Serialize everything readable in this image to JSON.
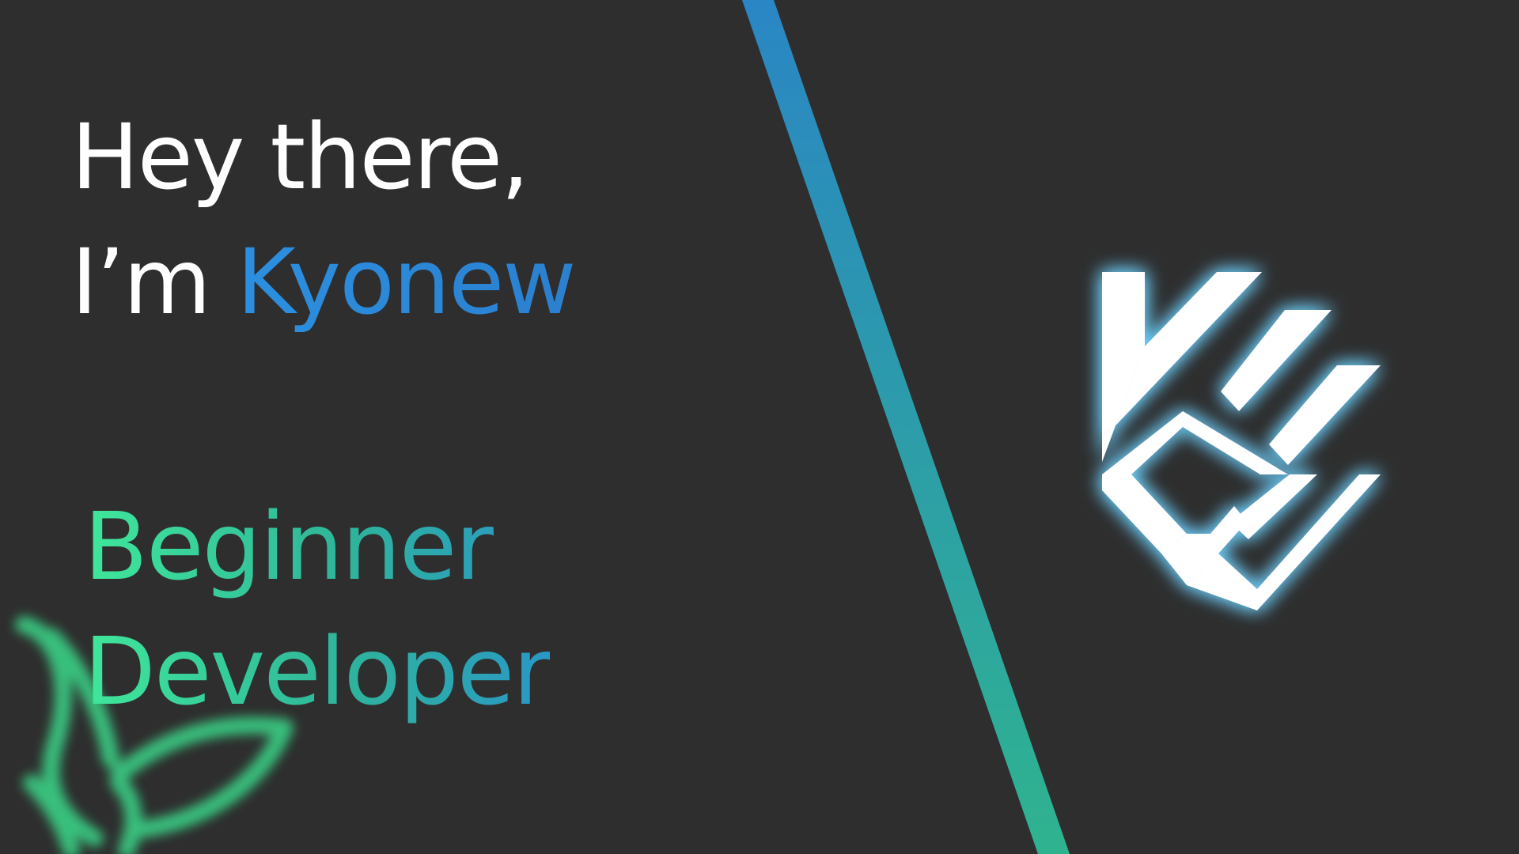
{
  "hero": {
    "greeting_line": "Hey there,",
    "intro_prefix": "I’m ",
    "name": "Kyonew",
    "role_line1": "Beginner",
    "role_line2": "Developer"
  },
  "colors": {
    "background": "#2e2e2e",
    "text_primary": "#ffffff",
    "name_accent": "#2c8fe0",
    "role_gradient_start": "#3fe79a",
    "role_gradient_end": "#2a97c6",
    "divider_top": "#2a86c4",
    "divider_bottom": "#2fb38f",
    "logo_fill": "#ffffff",
    "logo_glow": "#6fd2ff",
    "butterfly_glow": "#3bd98a"
  },
  "icons": {
    "logo": "kw-monogram-logo-icon",
    "butterfly": "butterfly-icon"
  }
}
